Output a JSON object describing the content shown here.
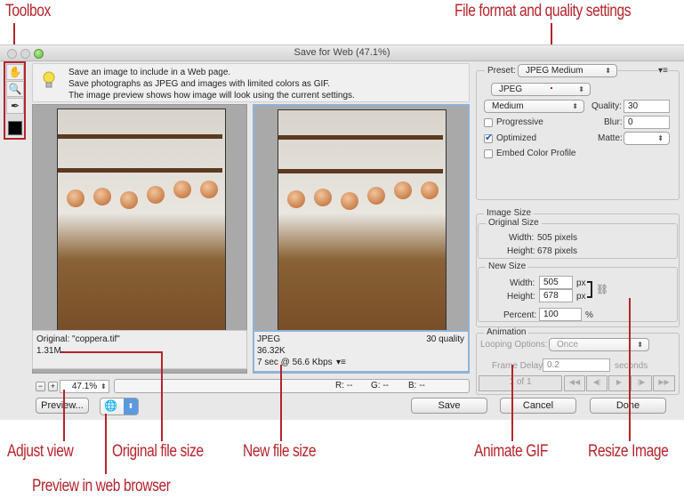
{
  "callouts": {
    "toolbox": "Toolbox",
    "file_format": "File format and quality settings",
    "adjust_view": "Adjust view",
    "original_file_size": "Original file size",
    "new_file_size": "New file size",
    "animate_gif": "Animate GIF",
    "resize_image": "Resize Image",
    "preview_browser": "Preview in web browser"
  },
  "window": {
    "title": "Save for Web (47.1%)"
  },
  "toolbox": {
    "tools": [
      "hand-tool",
      "zoom-tool",
      "eyedropper-tool"
    ],
    "tool_glyphs": [
      "✋",
      "🔍",
      "✒"
    ],
    "color_swatch": "#000000"
  },
  "tip": {
    "lines": [
      "Save an image to include in a Web page.",
      "Save photographs as JPEG and images with limited colors as GIF.",
      "The image preview shows how image will look using the current settings."
    ]
  },
  "original_info": {
    "name": "Original: \"coppera.tif\"",
    "size": "1.31M"
  },
  "optimized_info": {
    "format": "JPEG",
    "quality": "30 quality",
    "size": "36.32K",
    "download": "7 sec @ 56.6 Kbps",
    "menu_glyph": "▾≡"
  },
  "statusbar": {
    "zoom_out": "−",
    "zoom_in": "+",
    "zoom_value": "47.1%",
    "r": "R: --",
    "g": "G: --",
    "b": "B: --"
  },
  "buttons": {
    "preview": "Preview...",
    "save": "Save",
    "cancel": "Cancel",
    "done": "Done"
  },
  "settings": {
    "preset_label": "Preset:",
    "preset_value": "JPEG Medium",
    "menu_glyph": "▾≡",
    "format_value": "JPEG",
    "quality_preset": "Medium",
    "quality_label": "Quality:",
    "quality_value": "30",
    "progressive_label": "Progressive",
    "progressive_checked": false,
    "blur_label": "Blur:",
    "blur_value": "0",
    "optimized_label": "Optimized",
    "optimized_checked": true,
    "matte_label": "Matte:",
    "matte_value": "",
    "embed_label": "Embed Color Profile",
    "embed_checked": false
  },
  "image_size": {
    "title": "Image Size",
    "original_title": "Original Size",
    "orig_width_label": "Width:",
    "orig_width": "505 pixels",
    "orig_height_label": "Height:",
    "orig_height": "678 pixels",
    "new_title": "New Size",
    "width_label": "Width:",
    "width_value": "505",
    "height_label": "Height:",
    "height_value": "678",
    "unit": "px",
    "percent_label": "Percent:",
    "percent_value": "100",
    "percent_unit": "%"
  },
  "animation": {
    "title": "Animation",
    "looping_label": "Looping Options:",
    "looping_value": "Once",
    "delay_label": "Frame Delay:",
    "delay_value": "0.2",
    "delay_unit": "seconds",
    "frame_counter": "1 of 1",
    "controls": [
      "◀◀",
      "◀|",
      "▶",
      "|▶",
      "▶▶"
    ]
  }
}
